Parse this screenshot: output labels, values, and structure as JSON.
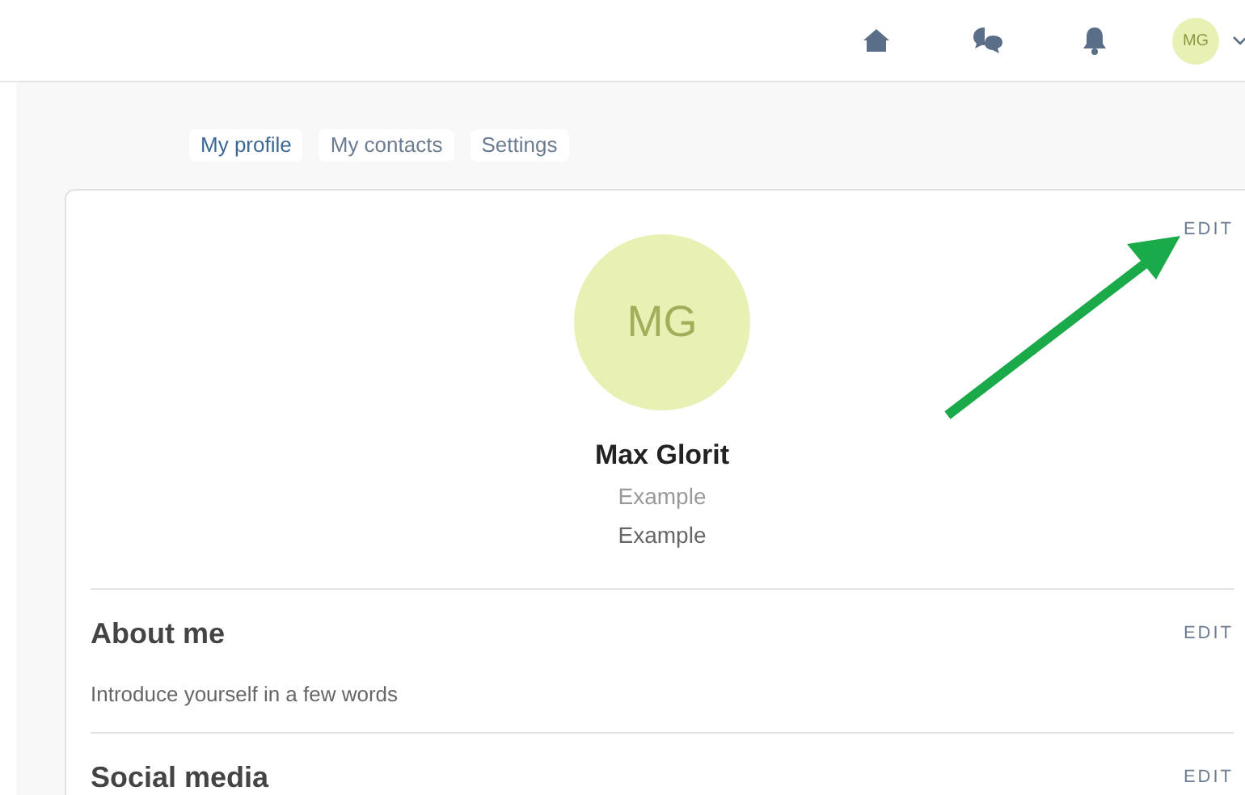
{
  "header": {
    "avatar_initials": "MG"
  },
  "tabs": [
    {
      "label": "My profile",
      "selected": true
    },
    {
      "label": "My contacts",
      "selected": false
    },
    {
      "label": "Settings",
      "selected": false
    }
  ],
  "profile": {
    "initials": "MG",
    "name": "Max Glorit",
    "line_1": "Example",
    "line_2": "Example",
    "edit": "EDIT"
  },
  "sections": [
    {
      "title": "About me",
      "edit": "EDIT",
      "text": "Introduce yourself in a few words"
    },
    {
      "title": "Social media",
      "edit": "EDIT"
    }
  ],
  "annotation": {
    "kind": "arrow"
  }
}
